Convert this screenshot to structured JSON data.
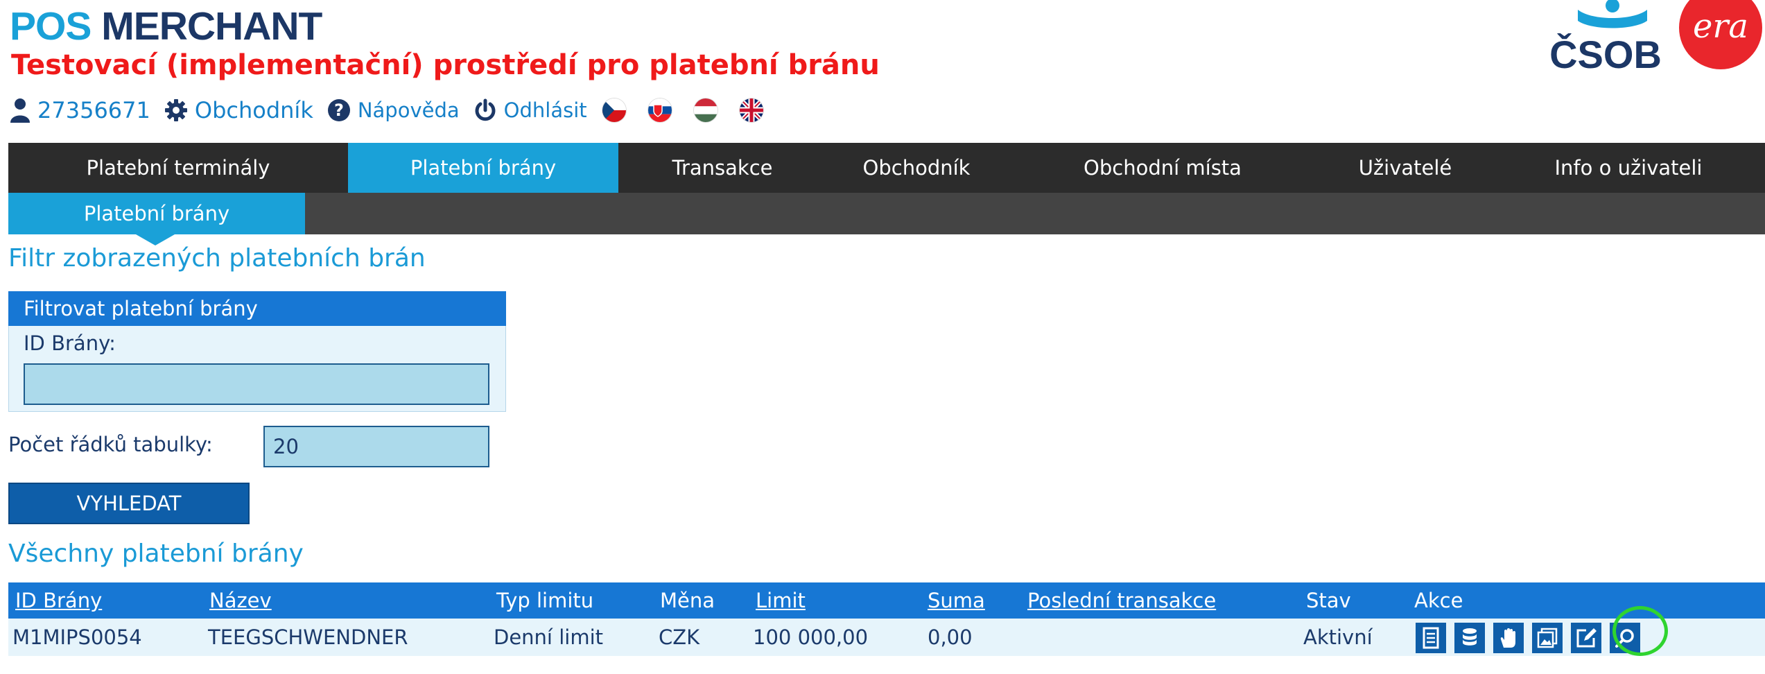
{
  "header": {
    "brand_part1": "POS",
    "brand_part2": "MERCHANT",
    "subtitle": "Testovací (implementační) prostředí pro platební bránu"
  },
  "userbar": {
    "user_id": "27356671",
    "merchant_link": "Obchodník",
    "help_link": "Nápověda",
    "logout_link": "Odhlásit",
    "icons": [
      "user-icon",
      "gear-icon",
      "help-icon",
      "power-icon"
    ],
    "languages": [
      "cs",
      "sk",
      "hu",
      "en"
    ]
  },
  "logos": {
    "csob_text": "ČSOB",
    "era_text": "era",
    "csob_color": "#1c3766",
    "era_color": "#e9262c"
  },
  "main_nav": [
    {
      "label": "Platební terminály",
      "active": false
    },
    {
      "label": "Platební brány",
      "active": true
    },
    {
      "label": "Transakce",
      "active": false
    },
    {
      "label": "Obchodník",
      "active": false
    },
    {
      "label": "Obchodní místa",
      "active": false
    },
    {
      "label": "Uživatelé",
      "active": false
    },
    {
      "label": "Info o uživateli",
      "active": false
    }
  ],
  "sub_nav": {
    "active_label": "Platební brány"
  },
  "filter_section": {
    "heading": "Filtr zobrazených platebních brán",
    "box_title": "Filtrovat platební brány",
    "id_label": "ID Brány:",
    "id_value": "",
    "rows_label": "Počet řádků tabulky:",
    "rows_value": "20",
    "search_button": "VYHLEDAT"
  },
  "table_section": {
    "heading": "Všechny platební brány",
    "columns": [
      "ID Brány",
      "Název",
      "Typ limitu",
      "Měna",
      "Limit",
      "Suma",
      "Poslední transakce",
      "Stav",
      "Akce"
    ],
    "rows": [
      {
        "id": "M1MIPS0054",
        "name": "TEEGSCHWENDNER",
        "limit_type": "Denní limit",
        "currency": "CZK",
        "limit": "100 000,00",
        "sum": "0,00",
        "last_transaction": "",
        "status": "Aktivní",
        "actions": [
          "document-icon",
          "database-icon",
          "hand-icon",
          "gallery-icon",
          "edit-icon",
          "search-icon"
        ]
      }
    ]
  },
  "colors": {
    "accent": "#1aa1d8",
    "nav_dark": "#2c2c2c",
    "table_header": "#1777d4",
    "button": "#0e5ea9",
    "highlight": "#2fd42f",
    "subtitle_red": "#ef1a1a"
  }
}
